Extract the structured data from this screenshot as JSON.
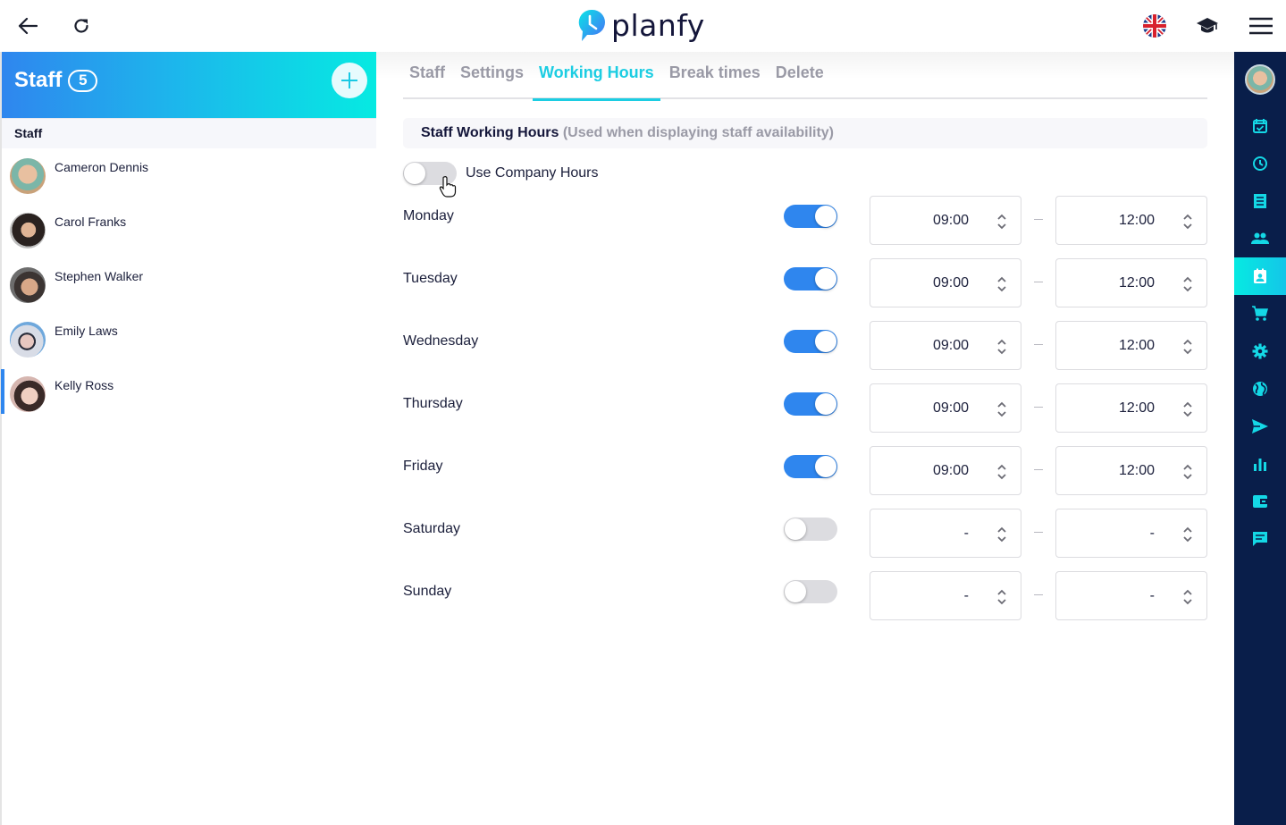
{
  "app": {
    "brand": "planfy"
  },
  "topbar": {
    "back_icon": "arrow-left-icon",
    "reload_icon": "refresh-icon",
    "language_icon": "uk-flag-icon",
    "tutorial_icon": "graduation-cap-icon",
    "menu_icon": "hamburger-menu-icon"
  },
  "left_panel": {
    "title": "Staff",
    "count": "5",
    "add_icon": "plus-icon",
    "section_label": "Staff",
    "staff": [
      {
        "name": "Cameron Dennis",
        "active": false
      },
      {
        "name": "Carol Franks",
        "active": false
      },
      {
        "name": "Stephen Walker",
        "active": false
      },
      {
        "name": "Emily Laws",
        "active": false
      },
      {
        "name": "Kelly Ross",
        "active": true
      }
    ]
  },
  "tabs": [
    {
      "label": "Staff",
      "active": false
    },
    {
      "label": "Settings",
      "active": false
    },
    {
      "label": "Working Hours",
      "active": true
    },
    {
      "label": "Break times",
      "active": false
    },
    {
      "label": "Delete",
      "active": false
    }
  ],
  "working_hours": {
    "section_title": "Staff Working Hours",
    "section_subtitle": "(Used when displaying staff availability)",
    "use_company_hours_label": "Use Company Hours",
    "use_company_hours": false,
    "days": [
      {
        "name": "Monday",
        "enabled": true,
        "start": "09:00",
        "end": "12:00"
      },
      {
        "name": "Tuesday",
        "enabled": true,
        "start": "09:00",
        "end": "12:00"
      },
      {
        "name": "Wednesday",
        "enabled": true,
        "start": "09:00",
        "end": "12:00"
      },
      {
        "name": "Thursday",
        "enabled": true,
        "start": "09:00",
        "end": "12:00"
      },
      {
        "name": "Friday",
        "enabled": true,
        "start": "09:00",
        "end": "12:00"
      },
      {
        "name": "Saturday",
        "enabled": false,
        "start": "-",
        "end": "-"
      },
      {
        "name": "Sunday",
        "enabled": false,
        "start": "-",
        "end": "-"
      }
    ]
  },
  "rail": {
    "items": [
      {
        "icon": "calendar-check-icon",
        "active": false
      },
      {
        "icon": "clock-icon",
        "active": false
      },
      {
        "icon": "receipt-icon",
        "active": false
      },
      {
        "icon": "customers-icon",
        "active": false
      },
      {
        "icon": "staff-badge-icon",
        "active": true
      },
      {
        "icon": "cart-icon",
        "active": false
      },
      {
        "icon": "gear-icon",
        "active": false
      },
      {
        "icon": "globe-icon",
        "active": false
      },
      {
        "icon": "send-icon",
        "active": false
      },
      {
        "icon": "bar-chart-icon",
        "active": false
      },
      {
        "icon": "wallet-icon",
        "active": false
      },
      {
        "icon": "chat-icon",
        "active": false
      }
    ]
  },
  "colors": {
    "accent": "#1ccde2",
    "toggle_on": "#2f86ee",
    "rail_bg": "#091e4a",
    "rail_icon": "#14d8e6"
  }
}
